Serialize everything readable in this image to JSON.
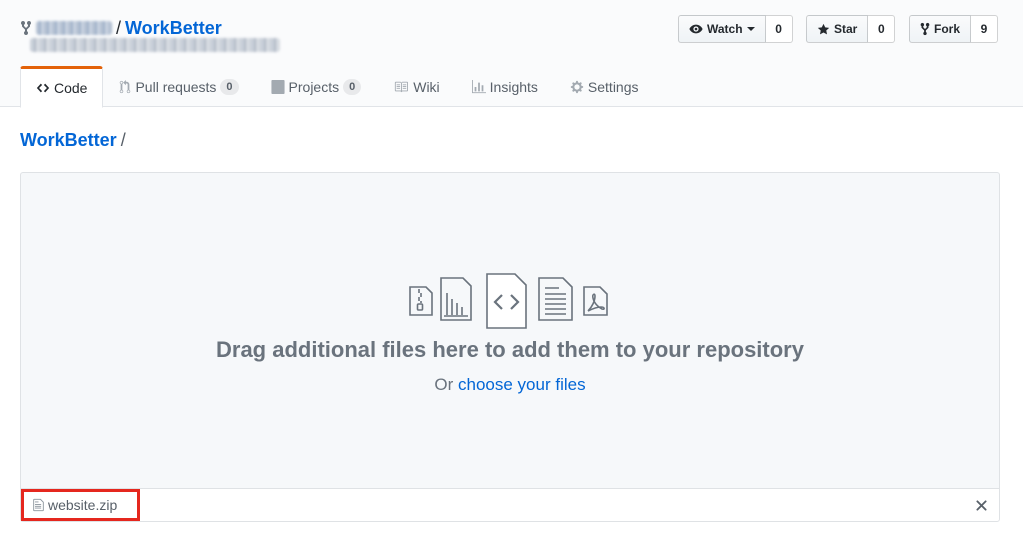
{
  "repo": {
    "separator": "/",
    "name": "WorkBetter"
  },
  "actions": {
    "watch": {
      "label": "Watch",
      "count": "0"
    },
    "star": {
      "label": "Star",
      "count": "0"
    },
    "fork": {
      "label": "Fork",
      "count": "9"
    }
  },
  "tabs": [
    {
      "label": "Code",
      "icon": "code-icon",
      "selected": true
    },
    {
      "label": "Pull requests",
      "icon": "pull-request-icon",
      "count": "0"
    },
    {
      "label": "Projects",
      "icon": "project-icon",
      "count": "0"
    },
    {
      "label": "Wiki",
      "icon": "book-icon"
    },
    {
      "label": "Insights",
      "icon": "graph-icon"
    },
    {
      "label": "Settings",
      "icon": "gear-icon"
    }
  ],
  "breadcrumb": {
    "repo": "WorkBetter",
    "slash": "/"
  },
  "dropzone": {
    "heading": "Drag additional files here to add them to your repository",
    "sub_prefix": "Or ",
    "choose_link": "choose your files"
  },
  "files": [
    {
      "name": "website.zip",
      "icon": "file-icon"
    }
  ],
  "colors": {
    "link": "#0366d6",
    "tab_accent": "#e36209",
    "highlight": "#e5271e"
  }
}
